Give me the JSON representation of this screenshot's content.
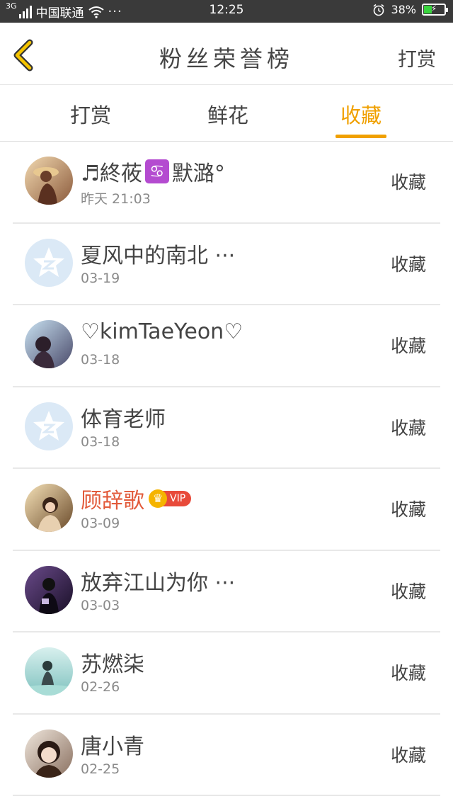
{
  "status_bar": {
    "network": "3G",
    "carrier": "中国联通",
    "more": "···",
    "time": "12:25",
    "battery": "38%",
    "battery_level": 0.38
  },
  "header": {
    "title": "粉丝荣誉榜",
    "action": "打赏"
  },
  "tabs": [
    {
      "label": "打赏",
      "active": false
    },
    {
      "label": "鲜花",
      "active": false
    },
    {
      "label": "收藏",
      "active": true
    }
  ],
  "fans": [
    {
      "name_prefix": "♬終莜",
      "zodiac": "♋",
      "name_suffix": "默潞°",
      "date": "昨天 21:03",
      "action": "收藏"
    },
    {
      "name": "夏风中的南北 ···",
      "date": "03-19",
      "action": "收藏"
    },
    {
      "name": "♡kimTaeYeon♡",
      "date": "03-18",
      "action": "收藏"
    },
    {
      "name": "体育老师",
      "date": "03-18",
      "action": "收藏"
    },
    {
      "name": "顾辞歌",
      "vip": "VIP",
      "date": "03-09",
      "action": "收藏"
    },
    {
      "name": "放弃江山为你 ···",
      "date": "03-03",
      "action": "收藏"
    },
    {
      "name": "苏燃柒",
      "date": "02-26",
      "action": "收藏"
    },
    {
      "name": "唐小青",
      "date": "02-25",
      "action": "收藏"
    }
  ],
  "colors": {
    "accent": "#f0a000",
    "vip_name": "#e25a3a",
    "vip_badge": "#e84a3a",
    "status_bar": "#3a3a3a"
  }
}
